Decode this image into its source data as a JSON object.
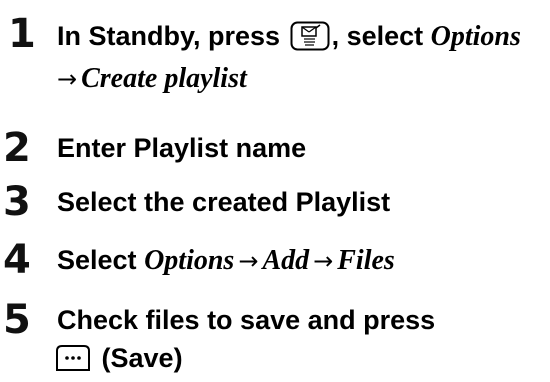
{
  "steps": [
    {
      "number": "1",
      "text_a": "In Standby, press",
      "key_icon": "mail-key-icon",
      "text_b": ", select",
      "text_c": "Options",
      "arrow": "→",
      "text_d": "Create playlist"
    },
    {
      "number": "2",
      "text": "Enter Playlist name"
    },
    {
      "number": "3",
      "text": "Select the created Playlist"
    },
    {
      "number": "4",
      "text_a": "Select",
      "text_b": "Options",
      "arrow1": "→",
      "text_c": "Add",
      "arrow2": "→",
      "text_d": "Files"
    },
    {
      "number": "5",
      "text_a": "Check files to save and press",
      "key_icon": "softkey-menu-icon",
      "text_b": "(Save)"
    }
  ]
}
